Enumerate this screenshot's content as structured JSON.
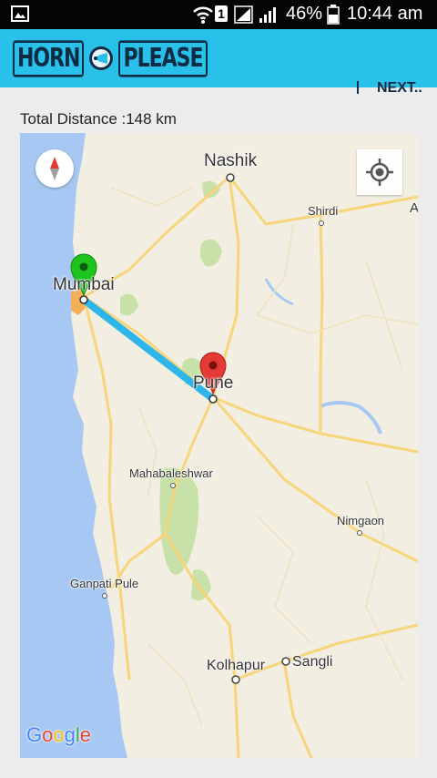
{
  "status_bar": {
    "battery_percent": "46%",
    "time": "10:44 am",
    "sim": "1"
  },
  "app_bar": {
    "logo_left": "HORN",
    "logo_right": "PLEASE",
    "next_label": "NEXT.."
  },
  "route": {
    "distance_label": "Total Distance :148 km"
  },
  "map": {
    "cities": {
      "nashik": "Nashik",
      "shirdi": "Shirdi",
      "mumbai": "Mumbai",
      "pune": "Pune",
      "mahabaleshwar": "Mahabaleshwar",
      "nimgaon": "Nimgaon",
      "ganpati_pule": "Ganpati Pule",
      "kolhapur": "Kolhapur",
      "sangli": "Sangli",
      "edge_a": "A"
    },
    "branding": {
      "letters": [
        "G",
        "o",
        "o",
        "g",
        "l",
        "e"
      ],
      "colors": [
        "#4285f4",
        "#ea4335",
        "#fbbc05",
        "#4285f4",
        "#34a853",
        "#ea4335"
      ]
    },
    "colors": {
      "route": "#2eb6ea",
      "start_marker": "#1ec31e",
      "end_marker": "#e53935",
      "sea": "#a7c8f2",
      "land": "#f3eee2",
      "road": "#f7d57a"
    }
  }
}
